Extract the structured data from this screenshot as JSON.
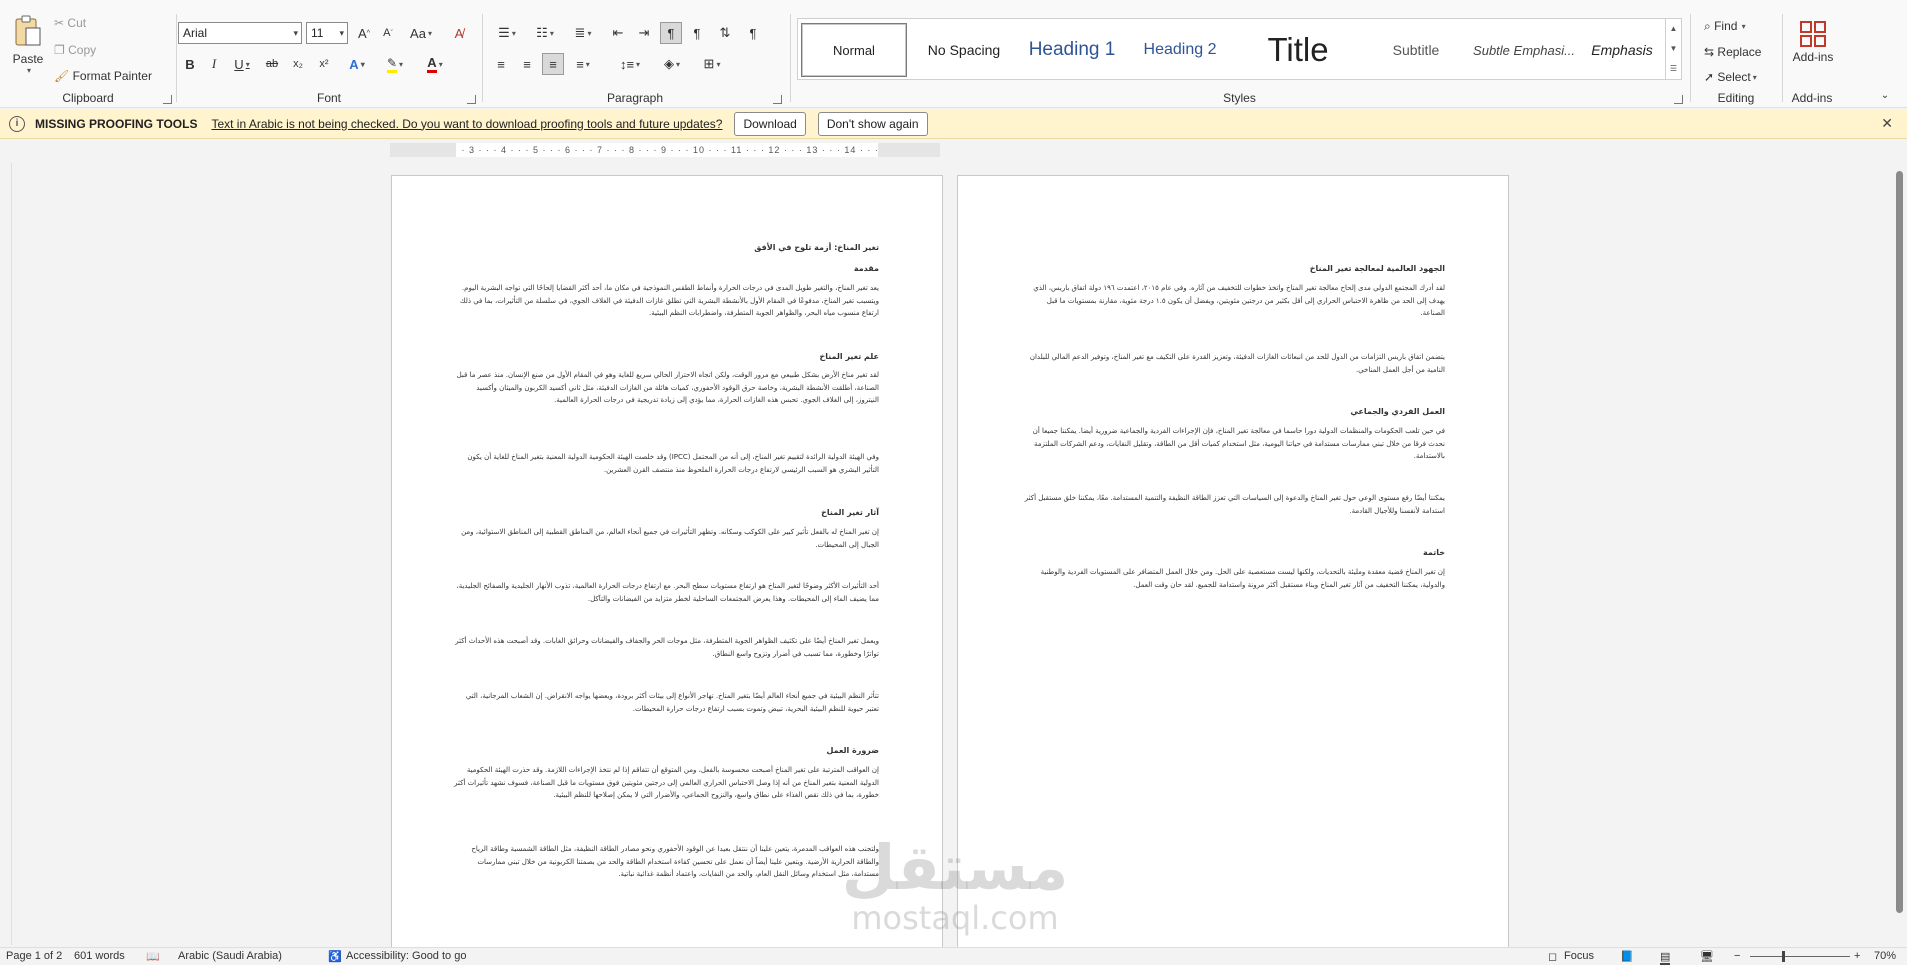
{
  "ribbon": {
    "clipboard": {
      "paste": "Paste",
      "cut": "Cut",
      "copy": "Copy",
      "format_painter": "Format Painter",
      "group": "Clipboard"
    },
    "font": {
      "name": "Arial",
      "size": "11",
      "group": "Font",
      "grow": "A^",
      "shrink": "Aˇ",
      "case": "Aa",
      "bold": "B",
      "italic": "I",
      "underline": "U",
      "strike": "ab",
      "sub": "x₂",
      "sup": "x²",
      "effects": "A",
      "highlight": "ab",
      "color": "A"
    },
    "paragraph": {
      "group": "Paragraph"
    },
    "styles": {
      "group": "Styles",
      "items": [
        "Normal",
        "No Spacing",
        "Heading 1",
        "Heading 2",
        "Title",
        "Subtitle",
        "Subtle Emphasi...",
        "Emphasis"
      ]
    },
    "editing": {
      "find": "Find",
      "replace": "Replace",
      "select": "Select",
      "group": "Editing"
    },
    "addins": {
      "label": "Add-ins",
      "group": "Add-ins"
    }
  },
  "message": {
    "title": "MISSING PROOFING TOOLS",
    "text": "Text in Arabic is not being checked. Do you want to download proofing tools and future updates?",
    "download": "Download",
    "dont_show": "Don't show again"
  },
  "ruler": "· · 1 · · · 2 · · · 3 · · · 4 · · · 5 · · · 6 · · · 7 · · · 8 · · · 9 · · · 10 · · · 11 · · · 12 · · · 13 · · · 14 · · · 15 · · · 16 ·",
  "page1": {
    "title": "تغير المناخ: أزمة تلوح في الأفق",
    "intro_h": "مقدمة",
    "intro_p": "يعد تغير المناخ، والتغير طويل المدى في درجات الحرارة وأنماط الطقس النموذجية في مكان ما، أحد أكثر القضايا إلحاحًا التي تواجه البشرية اليوم. ويتسبب تغير المناخ، مدفوعًا في المقام الأول بالأنشطة البشرية التي تطلق غازات الدفيئة في الغلاف الجوي، في سلسلة من التأثيرات، بما في ذلك ارتفاع منسوب مياه البحر، والظواهر الجوية المتطرفة، واضطرابات النظم البيئية.",
    "science_h": "علم تغير المناخ",
    "science_p": "لقد تغير مناخ الأرض بشكل طبيعي مع مرور الوقت، ولكن اتجاه الاحترار الحالي سريع للغاية وهو في المقام الأول من صنع الإنسان. منذ عصر ما قبل الصناعة، أطلقت الأنشطة البشرية، وخاصة حرق الوقود الأحفوري، كميات هائلة من الغازات الدفيئة، مثل ثاني أكسيد الكربون والميثان وأكسيد النيتروز، إلى الغلاف الجوي. تحبس هذه الغازات الحرارة، مما يؤدي إلى زيادة تدريجية في درجات الحرارة العالمية.",
    "ipcc_p": "وفي الهيئة الدولية الرائدة لتقييم تغير المناخ، إلى أنه من المحتمل (IPCC) وقد خلصت الهيئة الحكومية الدولية المعنية بتغير المناخ للغاية أن يكون التأثير البشري هو السبب الرئيسي لارتفاع درجات الحرارة الملحوظ منذ منتصف القرن العشرين.",
    "effects_h": "آثار تغير المناخ",
    "effects_p1": "إن تغير المناخ له بالفعل تأثير كبير على الكوكب وسكانه. وتظهر التأثيرات في جميع أنحاء العالم، من المناطق القطبية إلى المناطق الاستوائية، ومن الجبال إلى المحيطات.",
    "effects_p2": "أحد التأثيرات الأكثر وضوحًا لتغير المناخ هو ارتفاع مستويات سطح البحر. مع ارتفاع درجات الحرارة العالمية، تذوب الأنهار الجليدية والصفائح الجليدية، مما يضيف الماء إلى المحيطات. وهذا يعرض المجتمعات الساحلية لخطر متزايد من الفيضانات والتآكل.",
    "effects_p3": "ويعمل تغير المناخ أيضًا على تكثيف الظواهر الجوية المتطرفة، مثل موجات الحر والجفاف والفيضانات وحرائق الغابات. وقد أصبحت هذه الأحداث أكثر تواترًا وخطورة، مما تسبب في أضرار وتزوح واسع النطاق.",
    "effects_p4": "تتأثر النظم البيئية في جميع أنحاء العالم أيضًا بتغير المناخ. تهاجر الأنواع إلى بيئات أكثر برودة، ويعضها يواجه الانقراض. إن الشعاب المرجانية، التي تعتبر حيوية للنظم البيئية البحرية، تبيض وتموت بسبب ارتفاع درجات حرارة المحيطات.",
    "urgency_h": "ضرورة العمل",
    "urgency_p1": "إن العواقب المترتبة على تغير المناخ أصبحت محسوسة بالفعل، ومن المتوقع أن تتفاقم إذا لم نتخذ الإجراءات اللازمة. وقد حذرت الهيئة الحكومية الدولية المعنية بتغير المناخ من أنه إذا وصل الاحتباس الحراري العالمي إلى درجتين مئويتين فوق مستويات ما قبل الصناعة، فسوف نشهد تأثيرات أكثر خطورة، بما في ذلك نقص الغذاء على نطاق واسع، والنزوح الجماعي، والأضرار التي لا يمكن إصلاحها للنظم البيئية.",
    "urgency_p2": "ولتجنب هذه العواقب المدمرة، يتعين علينا أن ننتقل بعيدا عن الوقود الأحفوري ونحو مصادر الطاقة النظيفة، مثل الطاقة الشمسية وطاقة الرياح والطاقة الحرارية الأرضية. ويتعين علينا أيضاً أن نعمل على تحسين كفاءة استخدام الطاقة والحد من بصمتنا الكربونية من خلال تبني ممارسات مستدامة، مثل استخدام وسائل النقل العام، والحد من النفايات، واعتماد أنظمة غذائية نباتية."
  },
  "page2": {
    "global_h": "الجهود العالمية لمعالجة تغير المناخ",
    "global_p1": "لقد أدرك المجتمع الدولي مدى إلحاح معالجة تغير المناخ واتخذ خطوات للتخفيف من آثاره. وفي عام ٢٠١٥، اعتمدت ١٩٦ دولة اتفاق باريس، الذي يهدف إلى الحد من ظاهرة الاحتباس الحراري إلى أقل بكثير من درجتين مئويتين، ويفضل أن يكون ١.٥ درجة مئوية، مقارنة بمستويات ما قبل الصناعة.",
    "global_p2": "يتضمن اتفاق باريس التزامات من الدول للحد من انبعاثات الغازات الدفيئة، وتعزيز القدرة على التكيف مع تغير المناخ، وتوفير الدعم المالي للبلدان النامية من أجل العمل المناخي.",
    "collective_h": "العمل الفردي والجماعي",
    "collective_p1": "في حين تلعب الحكومات والمنظمات الدولية دورا حاسما في معالجة تغير المناخ، فإن الإجراءات الفردية والجماعية ضرورية أيضا. يمكننا جميعا أن نحدث فرقا من خلال تبني ممارسات مستدامة في حياتنا اليومية، مثل استخدام كميات أقل من الطاقة، وتقليل النفايات، ودعم الشركات الملتزمة بالاستدامة.",
    "collective_p2": "يمكننا أيضًا رفع مستوى الوعي حول تغير المناخ والدعوة إلى السياسات التي تعزز الطاقة النظيفة والتنمية المستدامة. معًا، يمكننا خلق مستقبل أكثر استدامة لأنفسنا وللأجيال القادمة.",
    "conclusion_h": "خاتمة",
    "conclusion_p": "إن تغير المناخ قضية معقدة ومليئة بالتحديات، ولكنها ليست مستعصية على الحل. ومن خلال العمل المتضافر على المستويات الفردية والوطنية والدولية، يمكننا التخفيف من آثار تغير المناخ وبناء مستقبل أكثر مرونة واستدامة للجميع. لقد حان وقت العمل."
  },
  "status": {
    "page": "Page 1 of 2",
    "words": "601 words",
    "language": "Arabic (Saudi Arabia)",
    "accessibility": "Accessibility: Good to go",
    "focus": "Focus",
    "zoom": "70%"
  },
  "watermark": {
    "ar": "مستقل",
    "en": "mostaql.com"
  }
}
